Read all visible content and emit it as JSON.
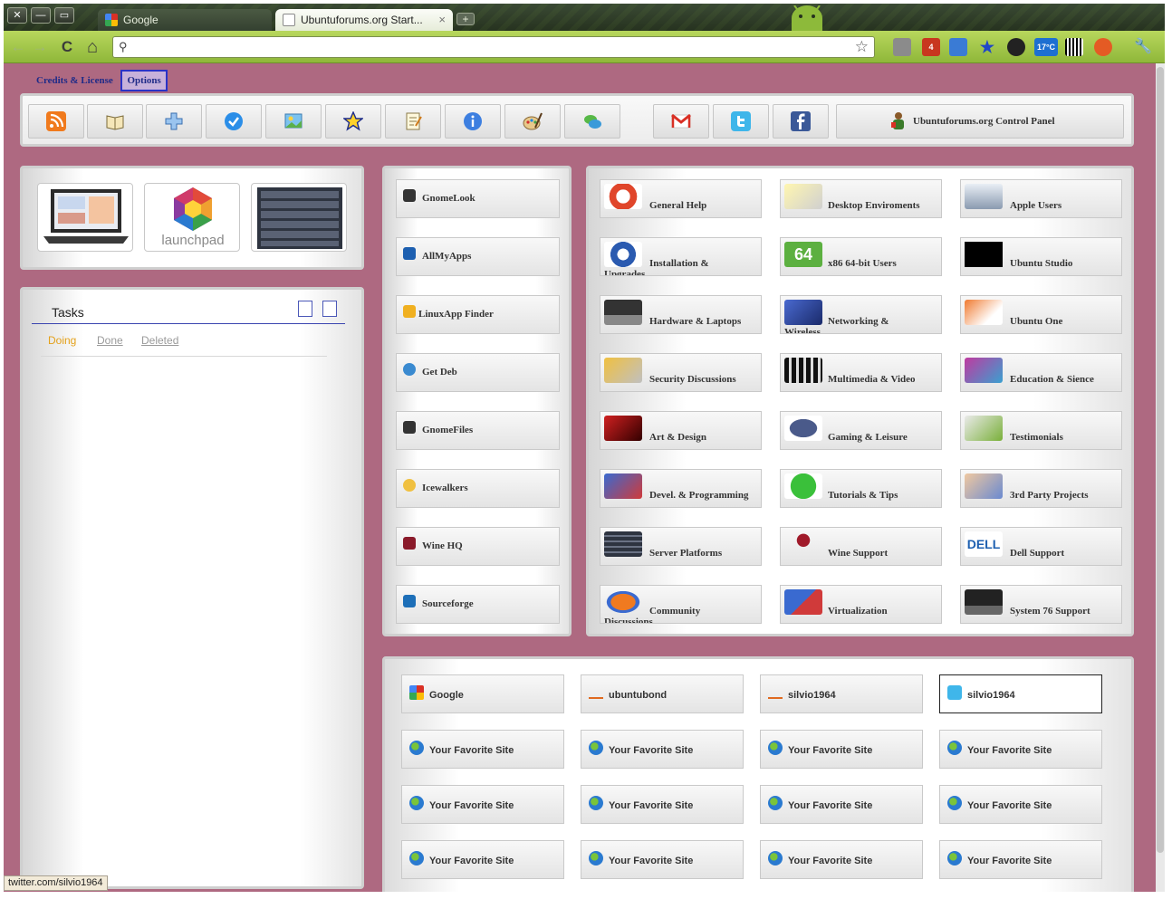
{
  "browser": {
    "tabs": [
      {
        "label": "Google"
      },
      {
        "label": "Ubuntuforums.org Start..."
      }
    ],
    "tab_close": "×",
    "new_tab": "+",
    "window_buttons": [
      "✕",
      "—",
      "▭"
    ],
    "nav": {
      "back": "←",
      "forward": "→",
      "reload": "C",
      "home": "⌂"
    },
    "omnibox": {
      "value": "",
      "search_glyph": "⚲",
      "star": "☆"
    },
    "extension_badges": [
      "4",
      "17°C"
    ]
  },
  "page": {
    "top_links": {
      "credits": "Credits & License",
      "options": "Options"
    },
    "toolbar_buttons": [
      "rss-icon",
      "book-icon",
      "plus-icon",
      "check-icon",
      "photo-icon",
      "star-icon",
      "notepad-icon",
      "info-icon",
      "paint-icon",
      "chat-icon",
      "gmail-icon",
      "twitter-icon",
      "facebook-icon"
    ],
    "control_panel_label": "Ubuntuforums.org Control Panel",
    "images": [
      "laptop-image",
      "launchpad-logo",
      "server-rack-image"
    ],
    "launchpad_text": "launchpad",
    "tasks": {
      "title": "Tasks",
      "tabs": [
        "Doing",
        "Done",
        "Deleted"
      ]
    },
    "apps": [
      "GnomeLook",
      "AllMyApps",
      "LinuxApp Finder",
      "Get Deb",
      "GnomeFiles",
      "Icewalkers",
      "Wine HQ",
      "Sourceforge"
    ],
    "forums": [
      {
        "line1": "General Help",
        "line2": ""
      },
      {
        "line1": "Desktop Enviroments",
        "line2": ""
      },
      {
        "line1": "Apple Users",
        "line2": ""
      },
      {
        "line1": "Installation &",
        "line2": "Upgrades"
      },
      {
        "line1": "x86 64-bit Users",
        "line2": ""
      },
      {
        "line1": "Ubuntu Studio",
        "line2": ""
      },
      {
        "line1": "Hardware & Laptops",
        "line2": ""
      },
      {
        "line1": "Networking &",
        "line2": "Wireless"
      },
      {
        "line1": "Ubuntu One",
        "line2": ""
      },
      {
        "line1": "Security Discussions",
        "line2": ""
      },
      {
        "line1": "Multimedia & Video",
        "line2": ""
      },
      {
        "line1": "Education & Sience",
        "line2": ""
      },
      {
        "line1": "Art & Design",
        "line2": ""
      },
      {
        "line1": "Gaming & Leisure",
        "line2": ""
      },
      {
        "line1": "Testimonials",
        "line2": ""
      },
      {
        "line1": "Devel. & Programming",
        "line2": ""
      },
      {
        "line1": "Tutorials & Tips",
        "line2": ""
      },
      {
        "line1": "3rd Party Projects",
        "line2": ""
      },
      {
        "line1": "Server Platforms",
        "line2": ""
      },
      {
        "line1": "Wine Support",
        "line2": ""
      },
      {
        "line1": "Dell Support",
        "line2": ""
      },
      {
        "line1": "Community",
        "line2": "Discussions"
      },
      {
        "line1": "Virtualization",
        "line2": ""
      },
      {
        "line1": "System 76 Support",
        "line2": ""
      }
    ],
    "forum_icon_texts": {
      "x86": "64",
      "dell": "DELL"
    },
    "favorites": [
      "Google",
      "ubuntubond",
      "silvio1964",
      "silvio1964",
      "Your Favorite Site",
      "Your Favorite Site",
      "Your Favorite Site",
      "Your Favorite Site",
      "Your Favorite Site",
      "Your Favorite Site",
      "Your Favorite Site",
      "Your Favorite Site",
      "Your Favorite Site",
      "Your Favorite Site",
      "Your Favorite Site",
      "Your Favorite Site"
    ]
  },
  "status_bar": {
    "url": "twitter.com/silvio1964"
  },
  "colors": {
    "page_bg": "#ae6981",
    "toolbar_green": "#a7c84c",
    "link_blue": "#1f2b88",
    "doing_orange": "#e4a11b"
  }
}
